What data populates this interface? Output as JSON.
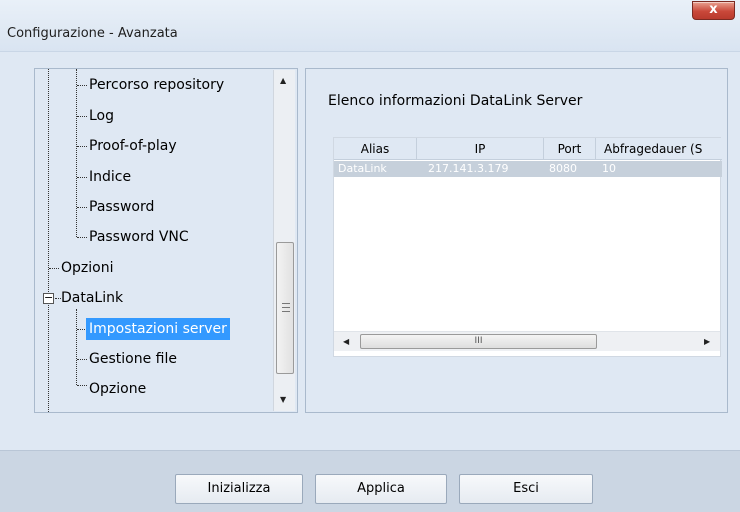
{
  "window": {
    "title": "Configurazione - Avanzata",
    "close_label": "x"
  },
  "tree": {
    "items": [
      {
        "label": "Percorso repository"
      },
      {
        "label": "Log"
      },
      {
        "label": "Proof-of-play"
      },
      {
        "label": "Indice"
      },
      {
        "label": "Password"
      },
      {
        "label": "Password VNC"
      },
      {
        "label": "Opzioni"
      },
      {
        "label": "DataLink",
        "expander": "−"
      },
      {
        "label": "Impostazioni server",
        "selected": true
      },
      {
        "label": "Gestione file"
      },
      {
        "label": "Opzione"
      }
    ]
  },
  "server_panel": {
    "heading": "Elenco informazioni DataLink Server",
    "columns": [
      "Alias",
      "IP",
      "Port",
      "Abfragedauer (S"
    ],
    "rows": [
      {
        "alias": "DataLink",
        "ip": "217.141.3.179",
        "port": "8080",
        "duration": "10"
      }
    ],
    "hscroll_grip": "III"
  },
  "buttons": {
    "init": "Inizializza",
    "apply": "Applica",
    "exit": "Esci"
  }
}
